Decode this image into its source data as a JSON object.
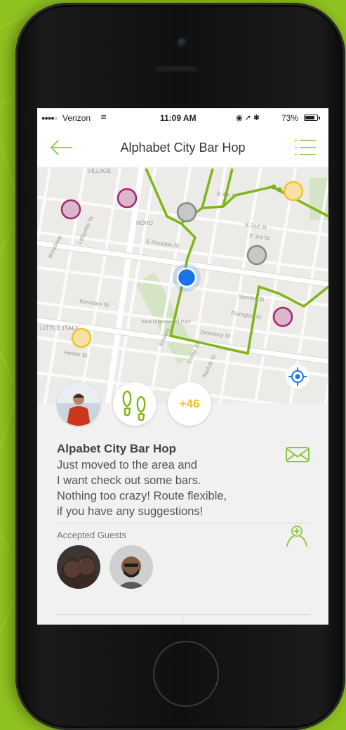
{
  "status_bar": {
    "signal": "●●●●○",
    "carrier": "Verizon",
    "wifi": "≋",
    "time": "11:09 AM",
    "icons": "◉ ➚ ✱",
    "battery": "73%"
  },
  "nav": {
    "title": "Alphabet City Bar Hop",
    "back_icon": "back-arrow-icon",
    "menu_icon": "list-menu-icon"
  },
  "map": {
    "labels": [
      "VILLAGE",
      "NOHO",
      "E Houston St",
      "LITTLE ITALY",
      "Kenmare St",
      "Delancey St",
      "Hester St",
      "Broadway",
      "Lafayette St",
      "Bowery",
      "Sara D Roosevelt Park",
      "E 3rd St",
      "E 2nd St",
      "E 4th St",
      "Stanton St",
      "Rivington St",
      "Norfolk St",
      "Essex St"
    ],
    "colors": {
      "route": "#7fb519",
      "visited": "#a12a6f",
      "planned": "#f1c232",
      "pending": "#8a8a8a",
      "current": "#1a73e8"
    }
  },
  "event": {
    "attendees_count": "+46",
    "title": "Alpabet City Bar Hop",
    "description_lines": [
      "Just moved to the area and",
      "I want check out some bars.",
      "Nothing too crazy! Route flexible,",
      "if you have any suggestions!"
    ],
    "guests_label": "Accepted Guests"
  },
  "accent_color": "#8cc63f"
}
